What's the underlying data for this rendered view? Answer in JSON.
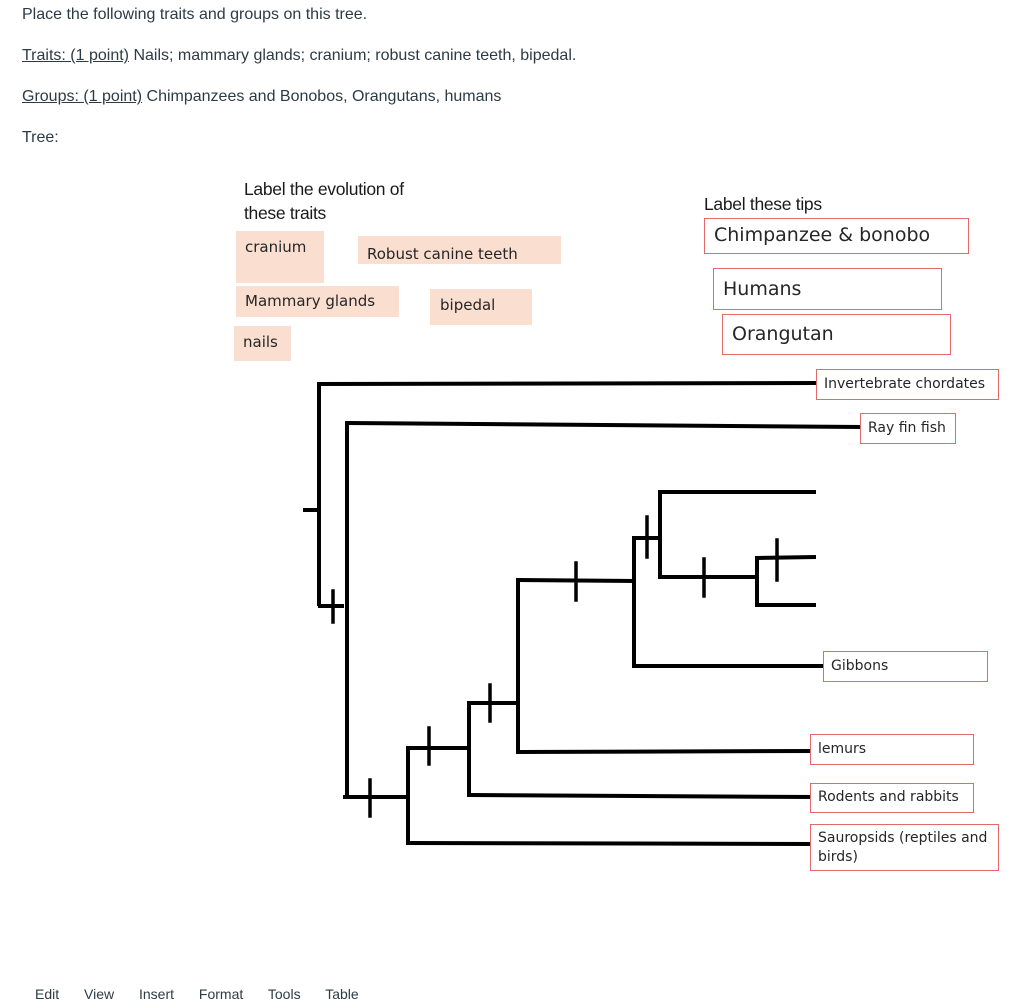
{
  "question": {
    "intro": "Place the following traits and groups on this tree.",
    "traits_label": "Traits: (1 point)",
    "traits_text": " Nails; mammary glands; cranium; robust canine teeth, bipedal.",
    "groups_label": "Groups: (1 point)",
    "groups_text": " Chimpanzees and Bonobos, Orangutans, humans",
    "tree_label": "Tree:"
  },
  "figure": {
    "traits_heading_line1": "Label the evolution of",
    "traits_heading_line2": "these traits",
    "trait_boxes": [
      "cranium",
      "Robust canine teeth",
      "Mammary glands",
      "bipedal",
      "nails"
    ],
    "tips_heading": "Label these tips",
    "tip_choices": [
      "Chimpanzee & bonobo",
      "Humans",
      "Orangutan"
    ],
    "tip_labels": {
      "invertebrate": "Invertebrate chordates",
      "rayfin": "Ray fin fish",
      "gibbons": "Gibbons",
      "lemurs": "lemurs",
      "rodents": "Rodents and rabbits",
      "sauropsids_line1": "Sauropsids (reptiles and",
      "sauropsids_line2": "birds)"
    },
    "colors": {
      "trait_fill": "#fadfd1",
      "tip_border": "#e36a6a",
      "branch": "#000000"
    }
  },
  "editor_menu": [
    "Edit",
    "View",
    "Insert",
    "Format",
    "Tools",
    "Table"
  ]
}
